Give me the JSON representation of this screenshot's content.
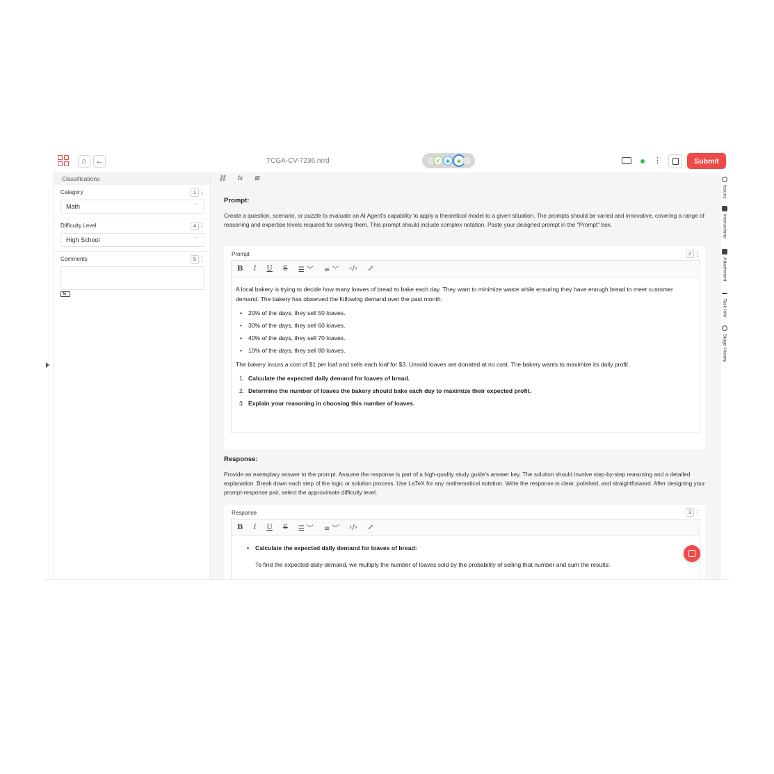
{
  "header": {
    "file_name": "TCGA-CV-7236.nrrd",
    "submit_label": "Submit"
  },
  "main_toolbar": {
    "fx_label": "fx"
  },
  "left_panel": {
    "title": "Classifications",
    "fields": [
      {
        "label": "Category",
        "badge": "1",
        "value": "Math"
      },
      {
        "label": "Difficulty Level",
        "badge": "4",
        "value": "High School"
      },
      {
        "label": "Comments",
        "badge": "5",
        "value": ""
      }
    ],
    "markdown_badge": "M↓"
  },
  "prompt_section": {
    "title": "Prompt:",
    "description": "Create a question, scenario, or puzzle to evaluate an AI Agent's capability to apply a theoretical model to a given situation. The prompts should be varied and innovative, covering a range of reasoning and expertise levels required for solving them. This prompt should include complex notation. Paste your designed prompt in the \"Prompt\" box.",
    "card_label": "Prompt",
    "card_badge": "2",
    "intro": "A local bakery is trying to decide how many loaves of bread to bake each day. They want to minimize waste while ensuring they have enough bread to meet customer demand. The bakery has observed the following demand over the past month:",
    "bullets": [
      "20% of the days, they sell 50 loaves.",
      "30% of the days, they sell 60 loaves.",
      "40% of the days, they sell 70 loaves.",
      "10% of the days, they sell 80 loaves."
    ],
    "cost_text": "The bakery incurs a cost of $1 per loaf and sells each loaf for $3. Unsold loaves are donated at no cost. The bakery wants to maximize its daily profit.",
    "questions": [
      {
        "n": "1.",
        "text": "Calculate the expected daily demand for loaves of bread."
      },
      {
        "n": "2.",
        "text": "Determine the number of loaves the bakery should bake each day to maximize their expected profit."
      },
      {
        "n": "3.",
        "text": "Explain your reasoning in choosing this number of loaves."
      }
    ]
  },
  "response_section": {
    "title": "Response:",
    "description": "Provide an exemplary answer to the prompt. Assume the response is part of a high-quality study guide's answer key. The solution should involve step-by-step reasoning and a detailed explanation. Break down each step of the logic or solution process. Use LaTeX for any mathematical notation. Write the response in clear, polished, and straightforward. After designing your prompt-response pair, select the approximate difficulty level.",
    "card_label": "Response",
    "card_badge": "3",
    "bullet_heading": "Calculate the expected daily demand for loaves of bread:",
    "body_text": "To find the expected daily demand, we multiply the number of loaves sold by the probability of selling that number and sum the results:"
  },
  "editor_toolbar": {
    "bold": "B",
    "italic": "I",
    "underline": "U",
    "strike": "S"
  },
  "right_rail": [
    {
      "label": "Issues",
      "icon": "chat-icon"
    },
    {
      "label": "Instructions",
      "icon": "book-icon"
    },
    {
      "label": "Attachment",
      "icon": "file-icon"
    },
    {
      "label": "Task Info",
      "icon": "dash-icon"
    },
    {
      "label": "Stage History",
      "icon": "clock-icon"
    }
  ],
  "colors": {
    "accent": "#ef4a4a",
    "status_online": "#2bbf4a",
    "progress_blue": "#2f86d1"
  }
}
